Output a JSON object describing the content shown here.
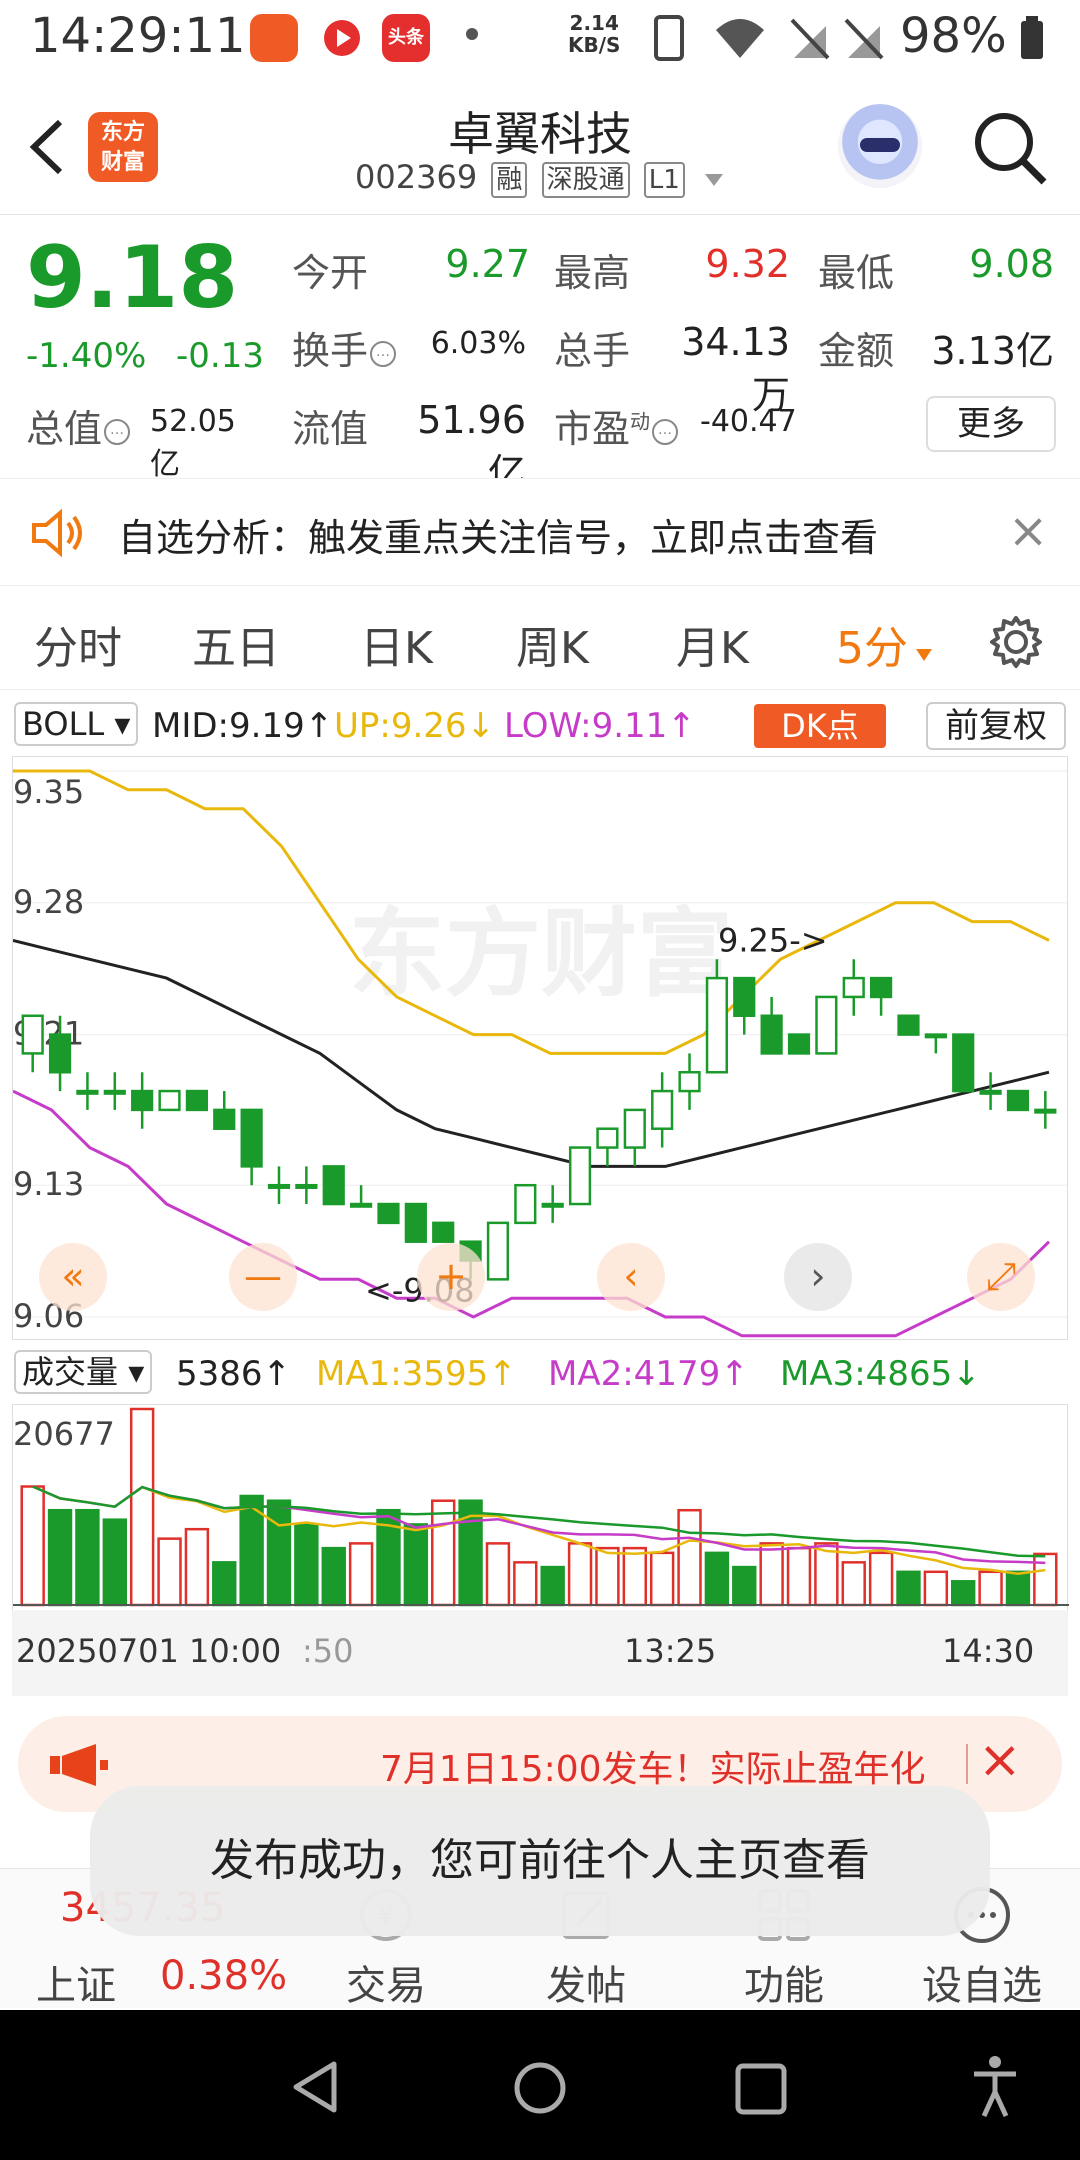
{
  "status_bar": {
    "time": "14:29:11",
    "net_speed_value": "2.14",
    "net_speed_unit": "KB/S",
    "battery": "98%",
    "app_badge_toutiao": "头条"
  },
  "header": {
    "logo_line1": "东方",
    "logo_line2": "财富",
    "stock_name": "卓翼科技",
    "stock_code": "002369",
    "tags": [
      "融",
      "深股通",
      "L1"
    ]
  },
  "quote": {
    "price": "9.18",
    "change_pct": "-1.40%",
    "change_abs": "-0.13",
    "open_label": "今开",
    "open": "9.27",
    "high_label": "最高",
    "high": "9.32",
    "low_label": "最低",
    "low": "9.08",
    "turnover_label": "换手",
    "turnover": "6.03%",
    "volume_label": "总手",
    "volume": "34.13万",
    "amount_label": "金额",
    "amount": "3.13亿",
    "total_value_label": "总值",
    "total_value": "52.05亿",
    "float_value_label": "流值",
    "float_value": "51.96亿",
    "pe_label": "市盈",
    "pe_sup": "动",
    "pe": "-40.47",
    "more_label": "更多"
  },
  "banner": {
    "text": "自选分析：触发重点关注信号，立即点击查看"
  },
  "tabs": [
    "分时",
    "五日",
    "日K",
    "周K",
    "月K",
    "5分"
  ],
  "active_tab_index": 5,
  "chart_header": {
    "indicator": "BOLL",
    "mid": "MID:9.19",
    "up": "UP:9.26",
    "low": "LOW:9.11",
    "dk_button": "DK点",
    "adjust_button": "前复权"
  },
  "volume_header": {
    "indicator": "成交量",
    "volume": "5386",
    "ma1": "MA1:3595",
    "ma2": "MA2:4179",
    "ma3": "MA3:4865"
  },
  "time_axis": {
    "start": "20250701 10:00",
    "start_tail": ":50",
    "mid": "13:25",
    "end": "14:30"
  },
  "chart_data": {
    "type": "candlestick",
    "y_ticks": [
      "9.35",
      "9.28",
      "9.21",
      "9.13",
      "9.06"
    ],
    "ylim": [
      9.06,
      9.35
    ],
    "annotations": [
      {
        "label": "9.25->",
        "value": 9.25
      },
      {
        "label": "<-9.08",
        "value": 9.08
      }
    ],
    "watermark": "东方财富",
    "candles": [
      {
        "o": 9.2,
        "h": 9.22,
        "l": 9.19,
        "c": 9.22
      },
      {
        "o": 9.21,
        "h": 9.22,
        "l": 9.18,
        "c": 9.19
      },
      {
        "o": 9.18,
        "h": 9.19,
        "l": 9.17,
        "c": 9.18
      },
      {
        "o": 9.18,
        "h": 9.19,
        "l": 9.17,
        "c": 9.18
      },
      {
        "o": 9.18,
        "h": 9.19,
        "l": 9.16,
        "c": 9.17
      },
      {
        "o": 9.17,
        "h": 9.18,
        "l": 9.17,
        "c": 9.18
      },
      {
        "o": 9.18,
        "h": 9.18,
        "l": 9.17,
        "c": 9.17
      },
      {
        "o": 9.17,
        "h": 9.18,
        "l": 9.16,
        "c": 9.16
      },
      {
        "o": 9.17,
        "h": 9.17,
        "l": 9.13,
        "c": 9.14
      },
      {
        "o": 9.13,
        "h": 9.14,
        "l": 9.12,
        "c": 9.13
      },
      {
        "o": 9.13,
        "h": 9.14,
        "l": 9.12,
        "c": 9.13
      },
      {
        "o": 9.14,
        "h": 9.14,
        "l": 9.12,
        "c": 9.12
      },
      {
        "o": 9.12,
        "h": 9.13,
        "l": 9.12,
        "c": 9.12
      },
      {
        "o": 9.12,
        "h": 9.12,
        "l": 9.11,
        "c": 9.11
      },
      {
        "o": 9.12,
        "h": 9.12,
        "l": 9.1,
        "c": 9.1
      },
      {
        "o": 9.11,
        "h": 9.11,
        "l": 9.1,
        "c": 9.1
      },
      {
        "o": 9.1,
        "h": 9.1,
        "l": 9.08,
        "c": 9.09
      },
      {
        "o": 9.08,
        "h": 9.11,
        "l": 9.08,
        "c": 9.11
      },
      {
        "o": 9.11,
        "h": 9.13,
        "l": 9.11,
        "c": 9.13
      },
      {
        "o": 9.12,
        "h": 9.13,
        "l": 9.11,
        "c": 9.12
      },
      {
        "o": 9.12,
        "h": 9.15,
        "l": 9.12,
        "c": 9.15
      },
      {
        "o": 9.15,
        "h": 9.16,
        "l": 9.14,
        "c": 9.16
      },
      {
        "o": 9.15,
        "h": 9.17,
        "l": 9.14,
        "c": 9.17
      },
      {
        "o": 9.16,
        "h": 9.19,
        "l": 9.15,
        "c": 9.18
      },
      {
        "o": 9.18,
        "h": 9.2,
        "l": 9.17,
        "c": 9.19
      },
      {
        "o": 9.19,
        "h": 9.25,
        "l": 9.19,
        "c": 9.24
      },
      {
        "o": 9.24,
        "h": 9.24,
        "l": 9.21,
        "c": 9.22
      },
      {
        "o": 9.22,
        "h": 9.23,
        "l": 9.2,
        "c": 9.2
      },
      {
        "o": 9.21,
        "h": 9.21,
        "l": 9.2,
        "c": 9.2
      },
      {
        "o": 9.2,
        "h": 9.23,
        "l": 9.2,
        "c": 9.23
      },
      {
        "o": 9.23,
        "h": 9.25,
        "l": 9.22,
        "c": 9.24
      },
      {
        "o": 9.24,
        "h": 9.24,
        "l": 9.22,
        "c": 9.23
      },
      {
        "o": 9.22,
        "h": 9.22,
        "l": 9.21,
        "c": 9.21
      },
      {
        "o": 9.21,
        "h": 9.21,
        "l": 9.2,
        "c": 9.21
      },
      {
        "o": 9.21,
        "h": 9.21,
        "l": 9.18,
        "c": 9.18
      },
      {
        "o": 9.18,
        "h": 9.19,
        "l": 9.17,
        "c": 9.18
      },
      {
        "o": 9.18,
        "h": 9.18,
        "l": 9.17,
        "c": 9.17
      },
      {
        "o": 9.17,
        "h": 9.18,
        "l": 9.16,
        "c": 9.17
      }
    ],
    "boll": {
      "up": [
        9.35,
        9.35,
        9.35,
        9.34,
        9.34,
        9.33,
        9.33,
        9.31,
        9.28,
        9.25,
        9.23,
        9.22,
        9.21,
        9.21,
        9.2,
        9.2,
        9.2,
        9.2,
        9.21,
        9.23,
        9.25,
        9.26,
        9.27,
        9.28,
        9.28,
        9.27,
        9.27,
        9.26
      ],
      "mid": [
        9.26,
        9.255,
        9.25,
        9.245,
        9.24,
        9.23,
        9.22,
        9.21,
        9.2,
        9.185,
        9.17,
        9.16,
        9.155,
        9.15,
        9.145,
        9.14,
        9.14,
        9.14,
        9.145,
        9.15,
        9.155,
        9.16,
        9.165,
        9.17,
        9.175,
        9.18,
        9.185,
        9.19
      ],
      "low": [
        9.18,
        9.17,
        9.15,
        9.14,
        9.12,
        9.11,
        9.1,
        9.09,
        9.08,
        9.08,
        9.07,
        9.07,
        9.06,
        9.07,
        9.07,
        9.07,
        9.07,
        9.06,
        9.06,
        9.05,
        9.05,
        9.05,
        9.05,
        9.05,
        9.06,
        9.07,
        9.08,
        9.1
      ]
    },
    "volume_ticks": [
      "20677"
    ],
    "volume_max": 20677,
    "volumes": [
      {
        "v": 12500,
        "up": true
      },
      {
        "v": 10000,
        "up": false
      },
      {
        "v": 10000,
        "up": false
      },
      {
        "v": 9000,
        "up": false
      },
      {
        "v": 20677,
        "up": true
      },
      {
        "v": 7000,
        "up": true
      },
      {
        "v": 8000,
        "up": true
      },
      {
        "v": 4500,
        "up": false
      },
      {
        "v": 11500,
        "up": false
      },
      {
        "v": 11000,
        "up": false
      },
      {
        "v": 8500,
        "up": false
      },
      {
        "v": 6000,
        "up": false
      },
      {
        "v": 6500,
        "up": true
      },
      {
        "v": 10000,
        "up": false
      },
      {
        "v": 8500,
        "up": false
      },
      {
        "v": 11000,
        "up": true
      },
      {
        "v": 11000,
        "up": false
      },
      {
        "v": 6500,
        "up": true
      },
      {
        "v": 4500,
        "up": true
      },
      {
        "v": 4000,
        "up": false
      },
      {
        "v": 6500,
        "up": true
      },
      {
        "v": 6000,
        "up": true
      },
      {
        "v": 6000,
        "up": true
      },
      {
        "v": 5500,
        "up": true
      },
      {
        "v": 10000,
        "up": true
      },
      {
        "v": 5500,
        "up": false
      },
      {
        "v": 4000,
        "up": false
      },
      {
        "v": 6500,
        "up": true
      },
      {
        "v": 6000,
        "up": true
      },
      {
        "v": 6500,
        "up": true
      },
      {
        "v": 4500,
        "up": true
      },
      {
        "v": 5500,
        "up": true
      },
      {
        "v": 3500,
        "up": false
      },
      {
        "v": 3500,
        "up": true
      },
      {
        "v": 2500,
        "up": false
      },
      {
        "v": 3500,
        "up": true
      },
      {
        "v": 3500,
        "up": false
      },
      {
        "v": 5386,
        "up": true
      }
    ]
  },
  "promo": {
    "text": "7月1日15:00发车！实际止盈年化"
  },
  "toast": {
    "text": "发布成功，您可前往个人主页查看"
  },
  "bottom_nav": {
    "index_name": "上证",
    "index_value": "3457.35",
    "index_change": "0.38%",
    "items": [
      "交易",
      "发帖",
      "功能",
      "设自选"
    ]
  },
  "colors": {
    "up_red": "#e0302a",
    "down_green": "#1a9a2b",
    "accent_orange": "#f07a10",
    "mid_line": "#222222",
    "up_line": "#e8b80c",
    "low_line": "#c63cc8"
  }
}
